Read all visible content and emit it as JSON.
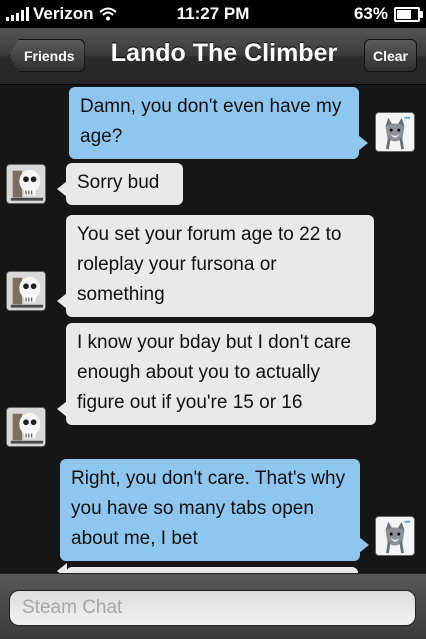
{
  "status_bar": {
    "carrier": "Verizon",
    "time": "11:27 PM",
    "battery_percent_label": "63%",
    "battery_level": 0.63
  },
  "nav": {
    "back_label": "Friends",
    "title": "Lando The Climber",
    "clear_label": "Clear"
  },
  "messages": [
    {
      "direction": "sent",
      "text": "Damn, you don't even have my age?",
      "avatar": "wolf-avatar"
    },
    {
      "direction": "received",
      "text": "Sorry bud",
      "avatar": "skull-avatar"
    },
    {
      "direction": "received",
      "text": "You set your forum age to 22 to roleplay your fursona or something",
      "avatar": "skull-avatar"
    },
    {
      "direction": "received",
      "text": "I know your bday but I don't care enough about you to actually figure out if you're 15 or 16",
      "avatar": "skull-avatar"
    },
    {
      "direction": "sent",
      "text": "Right, you don't care. That's why you have so many tabs open about me, I bet",
      "avatar": "wolf-avatar"
    }
  ],
  "input": {
    "placeholder": "Steam Chat",
    "value": ""
  },
  "colors": {
    "sent_bubble": "#8fc6ef",
    "received_bubble": "#e9e9e9"
  }
}
